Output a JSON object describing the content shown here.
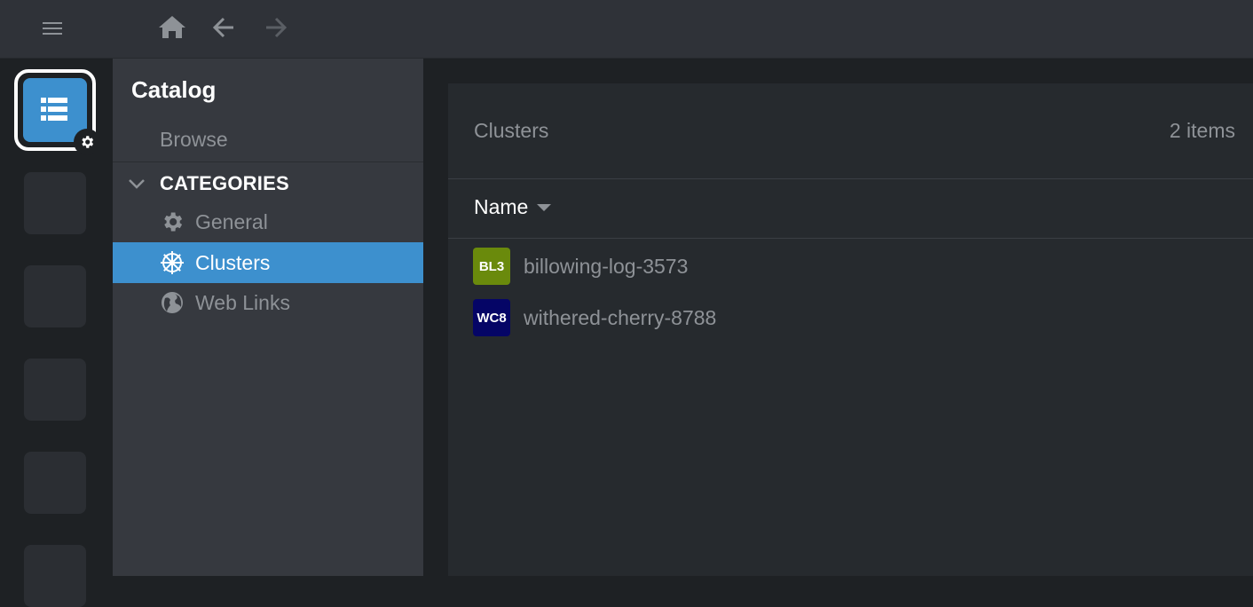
{
  "topbar": {
    "menu_icon": "hamburger-icon",
    "home_icon": "home-icon",
    "back_icon": "arrow-left-icon",
    "forward_icon": "arrow-right-icon"
  },
  "hotbar": {
    "active_icon": "catalog-list-icon",
    "badge_icon": "gear-icon",
    "slot_count": 5
  },
  "sidebar": {
    "title": "Catalog",
    "browse_label": "Browse",
    "categories_label": "CATEGORIES",
    "items": [
      {
        "label": "General",
        "icon": "gear-icon"
      },
      {
        "label": "Clusters",
        "icon": "kubernetes-helm-icon",
        "active": true
      },
      {
        "label": "Web Links",
        "icon": "globe-icon"
      }
    ]
  },
  "main": {
    "title": "Clusters",
    "count": "2 items",
    "column_name": "Name",
    "rows": [
      {
        "abbr": "BL3",
        "name": "billowing-log-3573",
        "color": "#6a8a0c"
      },
      {
        "abbr": "WC8",
        "name": "withered-cherry-8788",
        "color": "#050566"
      }
    ]
  },
  "colors": {
    "accent": "#3d90ce",
    "sidebar_bg": "#36393f",
    "main_bg": "#262a2e"
  }
}
